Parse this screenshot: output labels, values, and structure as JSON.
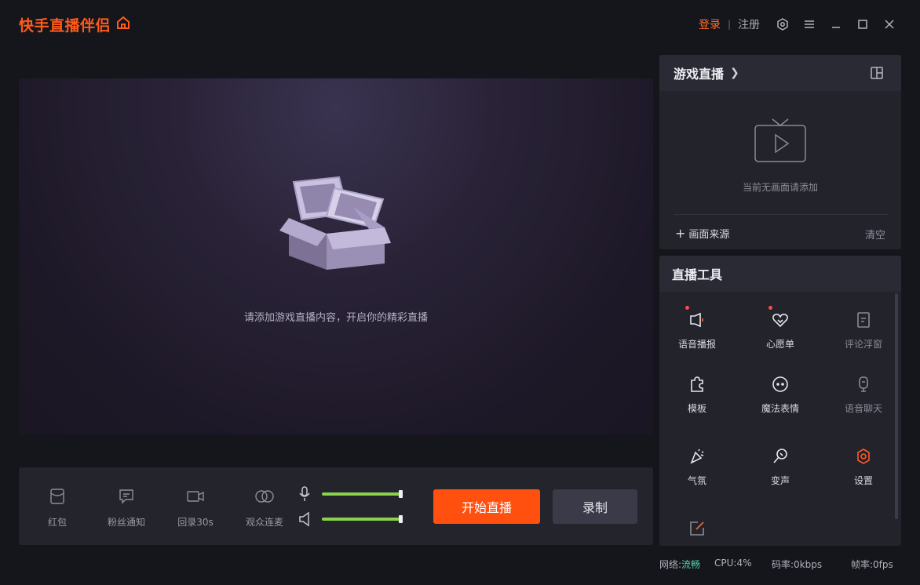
{
  "app": {
    "title": "快手直播伴侣",
    "login": "登录",
    "separator": "|",
    "register": "注册"
  },
  "preview": {
    "hint": "请添加游戏直播内容，开启你的精彩直播"
  },
  "bottom_tools": [
    {
      "label": "红包",
      "icon": "red-packet-icon"
    },
    {
      "label": "粉丝通知",
      "icon": "fan-notify-icon"
    },
    {
      "label": "回录30s",
      "icon": "replay-camera-icon"
    },
    {
      "label": "观众连麦",
      "icon": "co-host-icon"
    }
  ],
  "audio": {
    "mic_level": 1.0,
    "speaker_level": 1.0
  },
  "actions": {
    "start_live": "开始直播",
    "record": "录制"
  },
  "game_panel": {
    "title": "游戏直播",
    "empty_text": "当前无画面请添加",
    "add_source": "画面来源",
    "clear": "清空"
  },
  "tools_panel": {
    "title": "直播工具",
    "items": [
      {
        "label": "语音播报",
        "icon": "broadcast-icon",
        "dot": true
      },
      {
        "label": "心愿单",
        "icon": "heart-icon",
        "dot": true
      },
      {
        "label": "评论浮窗",
        "icon": "comment-window-icon"
      },
      {
        "label": "模板",
        "icon": "puzzle-icon"
      },
      {
        "label": "魔法表情",
        "icon": "magic-face-icon"
      },
      {
        "label": "语音聊天",
        "icon": "voice-chat-icon"
      },
      {
        "label": "气氛",
        "icon": "party-popper-icon"
      },
      {
        "label": "变声",
        "icon": "voice-changer-icon"
      },
      {
        "label": "设置",
        "icon": "settings-icon"
      },
      {
        "label": "",
        "icon": "edit-icon"
      }
    ]
  },
  "status": {
    "network_label": "网络:",
    "network_value": "流畅",
    "cpu": "CPU:4%",
    "bitrate": "码率:0kbps",
    "fps": "帧率:0fps"
  },
  "colors": {
    "accent": "#ff5010",
    "level": "#8ad24a",
    "network_ok": "#58d0a8"
  }
}
